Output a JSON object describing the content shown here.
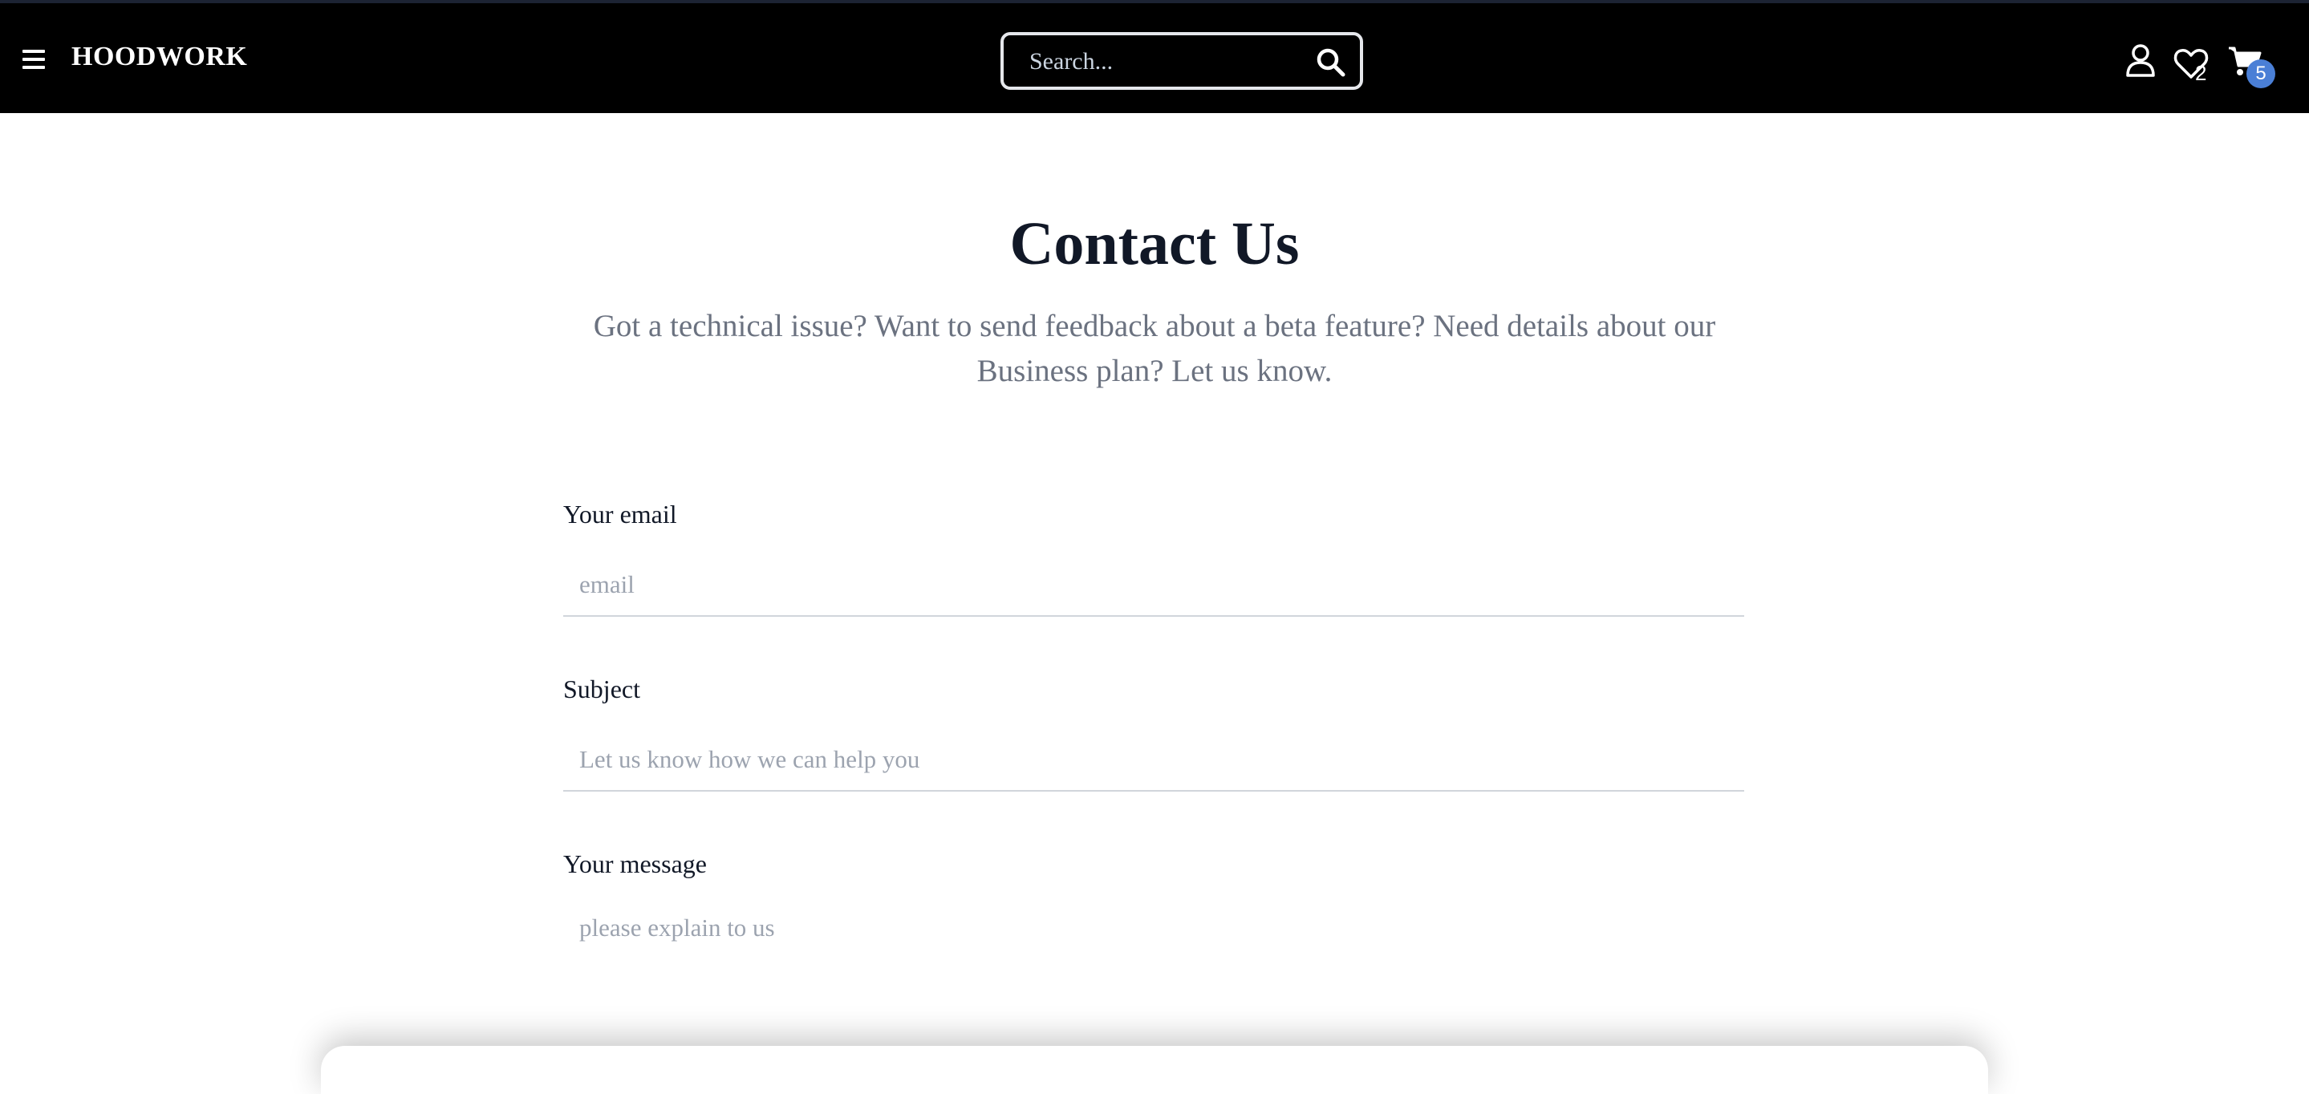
{
  "navbar": {
    "brand": "HOODWORK",
    "search_placeholder": "Search...",
    "wishlist_count": "2",
    "cart_count": "5"
  },
  "page": {
    "title": "Contact Us",
    "subtitle": "Got a technical issue? Want to send feedback about a beta feature? Need details about our Business plan? Let us know."
  },
  "form": {
    "email_label": "Your email",
    "email_placeholder": "email",
    "subject_label": "Subject",
    "subject_placeholder": "Let us know how we can help you",
    "message_label": "Your message",
    "message_placeholder": "please explain to us"
  },
  "colors": {
    "navbar_bg": "#000000",
    "badge_bg": "#4a7fd6",
    "title_text": "#111827",
    "subtitle_text": "#6b7280"
  }
}
